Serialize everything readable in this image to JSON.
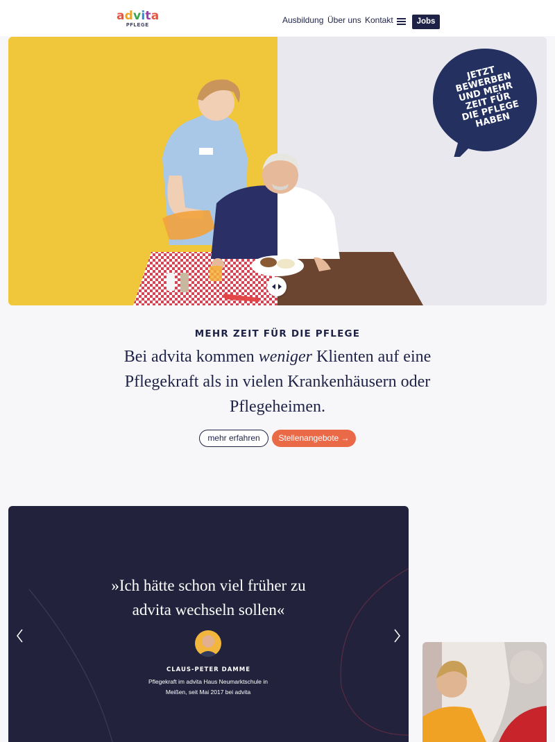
{
  "brand": {
    "logo_name": "advita",
    "logo_sub": "PFLEGE"
  },
  "nav": {
    "items": [
      "Ausbildung",
      "Über uns",
      "Kontakt"
    ],
    "menu_icon": "hamburger-menu-icon",
    "jobs_label": "Jobs"
  },
  "hero": {
    "bubble_lines": [
      "JETZT",
      "BEWERBEN",
      "UND MEHR",
      "ZEIT FÜR",
      "DIE PFLEGE",
      "HABEN"
    ],
    "slider_icon": "left-right-arrows-icon"
  },
  "intro": {
    "kicker": "MEHR ZEIT FÜR DIE PFLEGE",
    "text_before": "Bei advita kommen ",
    "text_emph": "weniger",
    "text_after": " Klienten auf eine Pflegekraft als in vielen Krankenhäusern oder Pflegeheimen.",
    "btn_more": "mehr erfahren",
    "btn_jobs": "Stellenangebote"
  },
  "testimonial": {
    "quote_line1": "»Ich hätte schon viel früher zu",
    "quote_line2": "advita wechseln sollen«",
    "name": "CLAUS-PETER DAMME",
    "role_line1": "Pflegekraft im advita Haus Neumarktschule in",
    "role_line2": "Meißen, seit Mai 2017 bei advita"
  },
  "colors": {
    "navy": "#1e2247",
    "testimonial_bg": "#22223c",
    "accent_orange": "#ea6a48",
    "hero_yellow": "#f0c63a",
    "hero_grey": "#e9e8ee"
  }
}
